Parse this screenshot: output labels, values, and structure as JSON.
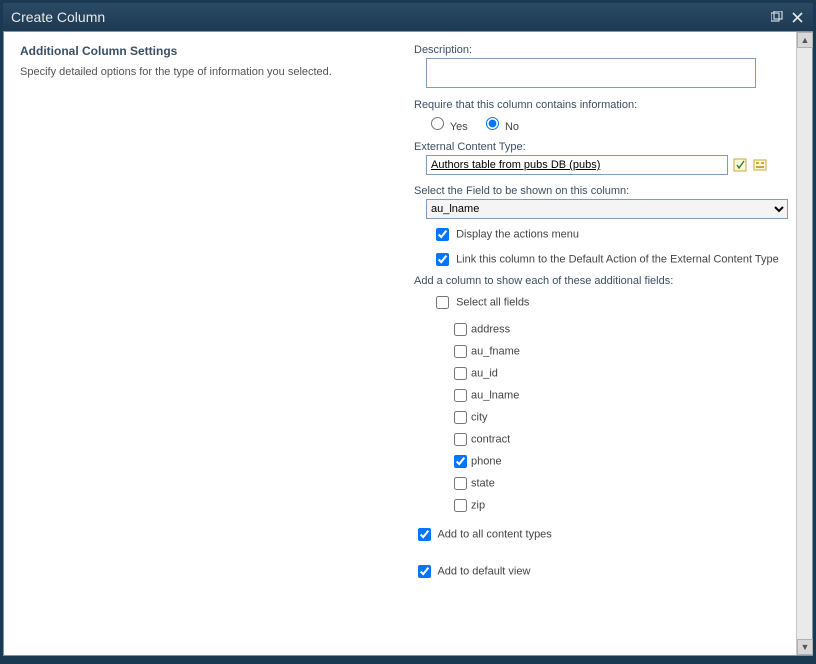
{
  "window": {
    "title": "Create Column"
  },
  "leftPane": {
    "sectionTitle": "Additional Column Settings",
    "sectionDesc": "Specify detailed options for the type of information you selected."
  },
  "form": {
    "descriptionLabel": "Description:",
    "descriptionValue": "",
    "requireLabel": "Require that this column contains information:",
    "yesLabel": "Yes",
    "noLabel": "No",
    "requireValue": "No",
    "ectLabel": "External Content Type:",
    "ectValue": "Authors table from pubs DB (pubs)",
    "selectFieldLabel": "Select the Field to be shown on this column:",
    "selectFieldValue": "au_lname",
    "displayActions": {
      "checked": true,
      "label": "Display the actions menu"
    },
    "linkDefault": {
      "checked": true,
      "label": "Link this column to the Default Action of the External Content Type"
    },
    "addFieldsLabel": "Add a column to show each of these additional fields:",
    "selectAll": {
      "checked": false,
      "label": "Select all fields"
    },
    "fields": [
      {
        "name": "address",
        "checked": false
      },
      {
        "name": "au_fname",
        "checked": false
      },
      {
        "name": "au_id",
        "checked": false
      },
      {
        "name": "au_lname",
        "checked": false
      },
      {
        "name": "city",
        "checked": false
      },
      {
        "name": "contract",
        "checked": false
      },
      {
        "name": "phone",
        "checked": true
      },
      {
        "name": "state",
        "checked": false
      },
      {
        "name": "zip",
        "checked": false
      }
    ],
    "addAllContentTypes": {
      "checked": true,
      "label": "Add to all content types"
    },
    "addDefaultView": {
      "checked": true,
      "label": "Add to default view"
    }
  }
}
